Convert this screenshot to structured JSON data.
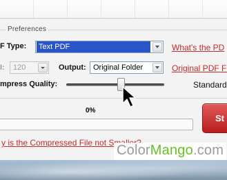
{
  "preferences": {
    "legend": "Preferences",
    "pdf_type_label": "F Type:",
    "pdf_type_value": "Text PDF",
    "dpi_value_label": "I:",
    "dpi_value": "120",
    "output_label": "Output:",
    "output_value": "Original Folder",
    "compress_quality_label": "mpress Quality:",
    "quality_value_text": "Standard",
    "quality_level_fraction": 0.56
  },
  "links": {
    "whats_pdf": "What's the PD",
    "original_pdf_folder": "Original PDF Fo",
    "why_not_smaller": "y is the Compressed File not Smaller?"
  },
  "progress": {
    "label": "0%",
    "fraction": 0
  },
  "actions": {
    "start_label": "St"
  },
  "watermark": {
    "brand_part1": "Color",
    "brand_part2": "Mango",
    "brand_part3": ".com"
  },
  "colors": {
    "link_red": "#c12b2b",
    "start_red": "#c52a2a",
    "selection_blue": "#2a55c8",
    "brand_green": "#6bbf2c"
  }
}
